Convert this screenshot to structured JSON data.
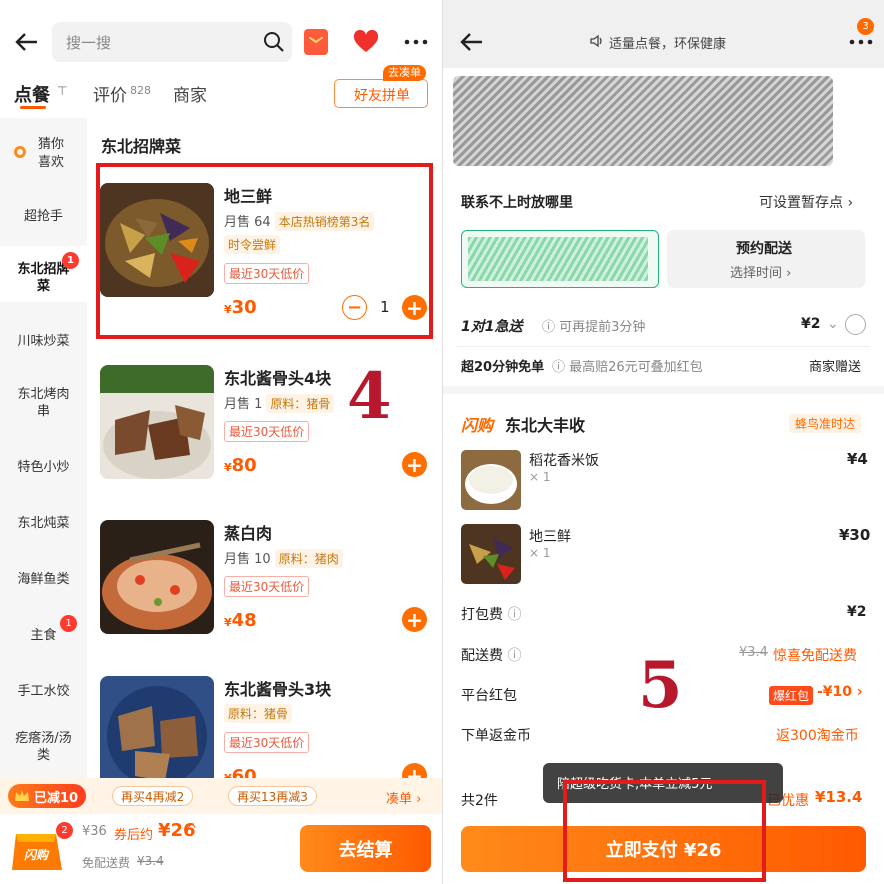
{
  "left": {
    "search_placeholder": "搜一搜",
    "tabs": {
      "order": "点餐",
      "reviews": "评价",
      "reviews_count": "828",
      "shop": "商家"
    },
    "group_order": {
      "tag": "去凑单",
      "label": "好友拼单"
    },
    "sidebar": [
      {
        "label": "猜你喜欢"
      },
      {
        "label": "超抢手"
      },
      {
        "label": "东北招牌菜",
        "badge": "1"
      },
      {
        "label": "川味炒菜"
      },
      {
        "label": "东北烤肉串"
      },
      {
        "label": "特色小炒"
      },
      {
        "label": "东北炖菜"
      },
      {
        "label": "海鲜鱼类"
      },
      {
        "label": "主食",
        "badge": "1"
      },
      {
        "label": "手工水饺"
      },
      {
        "label": "疙瘩汤/汤类"
      }
    ],
    "section_title": "东北招牌菜",
    "dishes": [
      {
        "name": "地三鲜",
        "sales": "月售 64",
        "tag1": "本店热销榜第3名",
        "tag2": "时令尝鲜",
        "tag3": "最近30天低价",
        "currency": "¥",
        "price": "30",
        "qty": "1"
      },
      {
        "name": "东北酱骨头4块",
        "sales": "月售 1",
        "tag1": "原料：猪骨",
        "tag3": "最近30天低价",
        "currency": "¥",
        "price": "80"
      },
      {
        "name": "蒸白肉",
        "sales": "月售 10",
        "tag1": "原料：猪肉",
        "tag3": "最近30天低价",
        "currency": "¥",
        "price": "48"
      },
      {
        "name": "东北酱骨头3块",
        "tag1": "原料：猪骨",
        "tag3": "最近30天低价",
        "currency": "¥",
        "price": "60"
      }
    ],
    "annotation": "4",
    "promo": {
      "badge": "已减10",
      "p1": "再买4再减2",
      "p2": "再买13再减3",
      "link": "凑单 ›"
    },
    "cart": {
      "count": "2",
      "logo": "闪购",
      "orig": "¥36",
      "after_label": "券后约",
      "after_price": "¥26",
      "delivery": "免配送费",
      "delivery_orig": "¥3.4",
      "checkout": "去结算"
    }
  },
  "right": {
    "header_notice": "适量点餐，环保健康",
    "more_badge": "3",
    "contact_label": "联系不上时放哪里",
    "contact_value": "可设置暂存点 ›",
    "schedule_title": "预约配送",
    "schedule_sub": "选择时间 ›",
    "express": {
      "title": "1对1急送",
      "desc": "可再提前3分钟",
      "price": "¥2"
    },
    "free_delivery": {
      "title": "超20分钟免单",
      "desc": "最高赔26元可叠加红包",
      "value": "商家赠送"
    },
    "shop": {
      "badge": "闪购",
      "name": "东北大丰收",
      "tag": "蜂鸟准时达"
    },
    "items": [
      {
        "name": "稻花香米饭",
        "qty": "× 1",
        "price": "¥4"
      },
      {
        "name": "地三鲜",
        "qty": "× 1",
        "price": "¥30"
      }
    ],
    "fees": [
      {
        "label": "打包费",
        "value": "¥2"
      },
      {
        "label": "配送费",
        "orig": "¥3.4",
        "value": "惊喜免配送费"
      },
      {
        "label": "平台红包",
        "badge": "爆红包",
        "value": "-¥10 ›"
      },
      {
        "label": "下单返金币",
        "value": "返300淘金币"
      }
    ],
    "summary": {
      "count": "共2件",
      "discount_label": "已优惠",
      "discount": "¥13.4"
    },
    "toast": "陪超级吃货卡,本单立减5元",
    "pay_button": "立即支付 ¥26",
    "annotation": "5"
  }
}
